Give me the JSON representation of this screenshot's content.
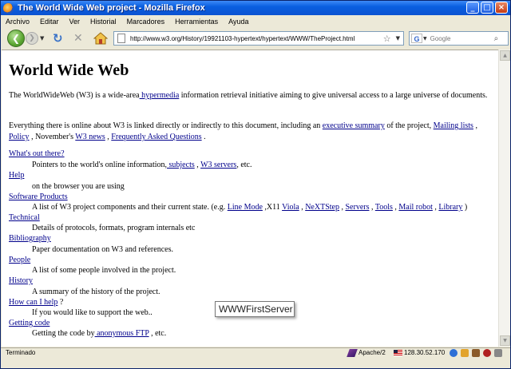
{
  "window": {
    "title": "The World Wide Web project - Mozilla Firefox",
    "controls": {
      "minimize": "_",
      "maximize": "□",
      "close": "×"
    }
  },
  "menubar": {
    "items": [
      "Archivo",
      "Editar",
      "Ver",
      "Historial",
      "Marcadores",
      "Herramientas",
      "Ayuda"
    ]
  },
  "navbar": {
    "url": "http://www.w3.org/History/19921103-hypertext/hypertext/WWW/TheProject.html",
    "search_placeholder": "Google",
    "search_engine": "G"
  },
  "page": {
    "title": "World Wide Web",
    "intro": {
      "before": "The WorldWideWeb (W3) is a wide-area",
      "link": " hypermedia",
      "after": " information retrieval initiative aiming to give universal access to a large universe of documents."
    },
    "para2": {
      "t1": "Everything there is online about W3 is linked directly or indirectly to this document, including an ",
      "l1": "executive summary",
      "t2": " of the project, ",
      "l2": "Mailing lists",
      "t3": " , ",
      "l3": "Policy",
      "t4": " , November's ",
      "l4": "W3 news",
      "t5": " , ",
      "l5": "Frequently Asked Questions",
      "t6": " ."
    },
    "sections": {
      "whats_out": {
        "term": "What's out there?",
        "def_before": "Pointers to the world's online information,",
        "link1": " subjects",
        "sep": " , ",
        "link2": "W3 servers",
        "def_after": ", etc."
      },
      "help": {
        "term": "Help",
        "def": "on the browser you are using"
      },
      "software": {
        "term": "Software Products",
        "def_before": "A list of W3 project components and their current state. (e.g. ",
        "links": [
          "Line Mode",
          "Viola",
          "NeXTStep",
          "Servers",
          "Tools",
          "Mail robot",
          "Library"
        ],
        "mid": " ,X11 ",
        "close": " )"
      },
      "technical": {
        "term": "Technical",
        "def": "Details of protocols, formats, program internals etc"
      },
      "bibliography": {
        "term": "Bibliography",
        "def": "Paper documentation on W3 and references."
      },
      "people": {
        "term": "People",
        "def": "A list of some people involved in the project."
      },
      "history": {
        "term": "History",
        "def": "A summary of the history of the project."
      },
      "howcan": {
        "term": "How can I help",
        "term_after": " ?",
        "def": "If you would like to support the web.."
      },
      "getting": {
        "term": "Getting code",
        "def_before": "Getting the code by",
        "link": " anonymous FTP",
        "def_after": " , etc."
      }
    },
    "tooltip": "WWWFirstServer"
  },
  "statusbar": {
    "status": "Terminado",
    "server": "Apache/2",
    "ip": "128.30.52.170"
  }
}
